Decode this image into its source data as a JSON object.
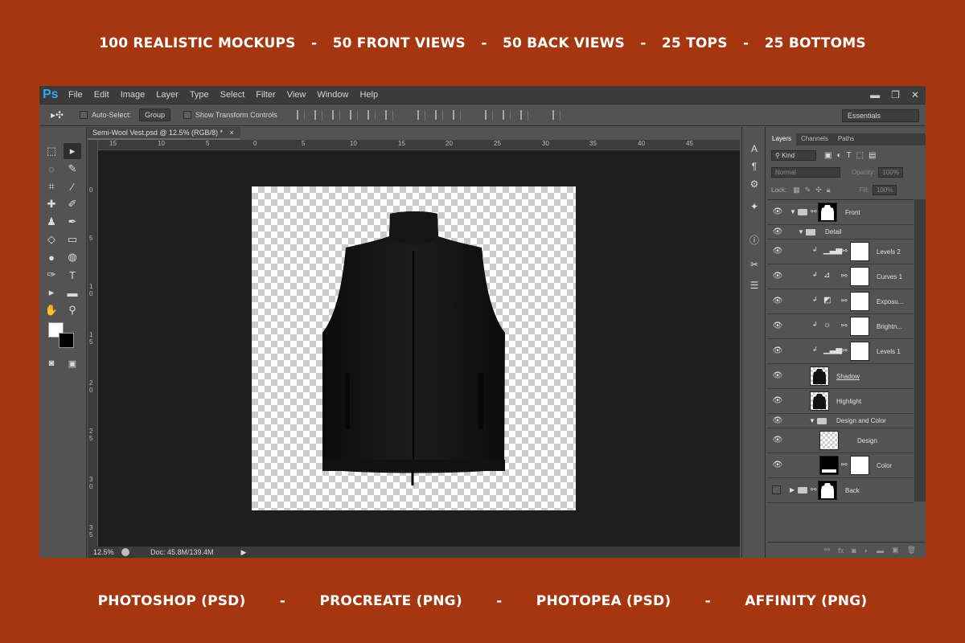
{
  "banner_top": [
    "100 REALISTIC MOCKUPS",
    "50 FRONT VIEWS",
    "50 BACK VIEWS",
    "25 TOPS",
    "25 BOTTOMS"
  ],
  "banner_bottom": [
    "PHOTOSHOP (PSD)",
    "PROCREATE (PNG)",
    "PHOTOPEA (PSD)",
    "AFFINITY (PNG)"
  ],
  "separator": "-",
  "app": {
    "logo": "Ps",
    "menu": [
      "File",
      "Edit",
      "Image",
      "Layer",
      "Type",
      "Select",
      "Filter",
      "View",
      "Window",
      "Help"
    ],
    "window_controls": [
      "▬",
      "❐",
      "✕"
    ]
  },
  "options": {
    "auto_select_label": "Auto-Select:",
    "auto_select_value": "Group",
    "show_transform_label": "Show Transform Controls",
    "workspace": "Essentials"
  },
  "document": {
    "tab_title": "Semi-Wool Vest.psd @ 12.5% (RGB/8) *",
    "close": "×",
    "ruler_h": [
      "15",
      "10",
      "5",
      "0",
      "5",
      "10",
      "15",
      "20",
      "25",
      "30",
      "35",
      "40",
      "45"
    ],
    "ruler_v": [
      "0",
      "5",
      "1 0",
      "1 5",
      "2 0",
      "2 5",
      "3 0",
      "3 5"
    ],
    "zoom": "12.5%",
    "doc_size": "Doc: 45.8M/139.4M"
  },
  "layers_panel": {
    "tabs": [
      "Layers",
      "Channels",
      "Paths"
    ],
    "filter_kind": "Kind",
    "blend_mode": "Normal",
    "opacity_label": "Opacity:",
    "opacity_value": "100%",
    "lock_label": "Lock:",
    "fill_label": "Fill:",
    "fill_value": "100%",
    "layers": [
      {
        "name": "Front",
        "type": "group",
        "visible": true
      },
      {
        "name": "Detail",
        "type": "subgroup",
        "visible": true
      },
      {
        "name": "Levels 2",
        "type": "adjustment",
        "icon": "levels-icon",
        "visible": true
      },
      {
        "name": "Curves 1",
        "type": "adjustment",
        "icon": "curves-icon",
        "visible": true
      },
      {
        "name": "Exposu...",
        "type": "adjustment",
        "icon": "exposure-icon",
        "visible": true
      },
      {
        "name": "Brightn...",
        "type": "adjustment",
        "icon": "brightness-icon",
        "visible": true
      },
      {
        "name": "Levels 1",
        "type": "adjustment",
        "icon": "levels-icon",
        "visible": true
      },
      {
        "name": "Shadow",
        "type": "pixel",
        "visible": true
      },
      {
        "name": "Highlight",
        "type": "pixel",
        "visible": true
      },
      {
        "name": "Design and Color",
        "type": "subgroup",
        "visible": true
      },
      {
        "name": "Design",
        "type": "smart",
        "visible": true
      },
      {
        "name": "Color",
        "type": "fill",
        "visible": true
      },
      {
        "name": "Back",
        "type": "group",
        "visible": false
      }
    ]
  }
}
